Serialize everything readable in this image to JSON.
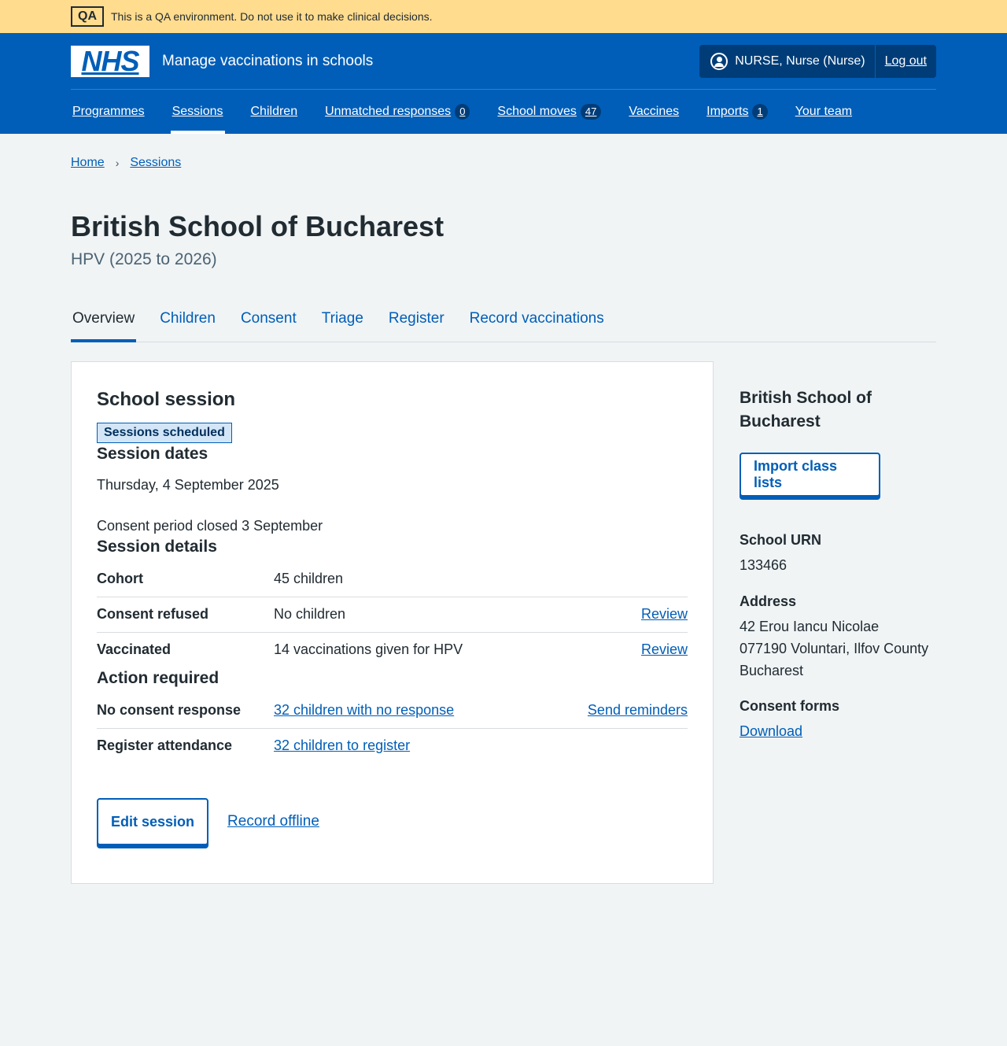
{
  "qa_banner": {
    "tag": "QA",
    "text": "This is a QA environment. Do not use it to make clinical decisions."
  },
  "header": {
    "logo_text": "NHS",
    "service_name": "Manage vaccinations in schools",
    "account_user": "NURSE, Nurse (Nurse)",
    "logout_label": "Log out",
    "nav": [
      {
        "label": "Programmes"
      },
      {
        "label": "Sessions",
        "active": true
      },
      {
        "label": "Children"
      },
      {
        "label": "Unmatched responses",
        "count": "0"
      },
      {
        "label": "School moves",
        "count": "47"
      },
      {
        "label": "Vaccines"
      },
      {
        "label": "Imports",
        "count": "1"
      },
      {
        "label": "Your team"
      }
    ]
  },
  "breadcrumb": [
    {
      "label": "Home"
    },
    {
      "label": "Sessions"
    }
  ],
  "page": {
    "title": "British School of Bucharest",
    "subtitle": "HPV (2025 to 2026)"
  },
  "tabs": [
    {
      "label": "Overview",
      "active": true
    },
    {
      "label": "Children"
    },
    {
      "label": "Consent"
    },
    {
      "label": "Triage"
    },
    {
      "label": "Register"
    },
    {
      "label": "Record vaccinations"
    }
  ],
  "card": {
    "heading": "School session",
    "status_tag": "Sessions scheduled",
    "session_dates_heading": "Session dates",
    "session_date": "Thursday, 4 September 2025",
    "consent_period": "Consent period closed 3 September",
    "session_details_heading": "Session details",
    "details": [
      {
        "key": "Cohort",
        "value": "45 children",
        "action": ""
      },
      {
        "key": "Consent refused",
        "value": "No children",
        "action": "Review"
      },
      {
        "key": "Vaccinated",
        "value": "14 vaccinations given for HPV",
        "action": "Review"
      }
    ],
    "action_heading": "Action required",
    "actions": [
      {
        "key": "No consent response",
        "value": "32 children with no response",
        "action": "Send reminders"
      },
      {
        "key": "Register attendance",
        "value": "32 children to register",
        "action": ""
      }
    ],
    "edit_button": "Edit session",
    "record_offline": "Record offline"
  },
  "sidebar": {
    "school_name": "British School of Bucharest",
    "import_button": "Import class lists",
    "urn_label": "School URN",
    "urn_value": "133466",
    "address_label": "Address",
    "address_lines": [
      "42 Erou Iancu Nicolae",
      "077190 Voluntari, Ilfov County",
      "Bucharest"
    ],
    "consent_forms_label": "Consent forms",
    "consent_forms_link": "Download"
  }
}
